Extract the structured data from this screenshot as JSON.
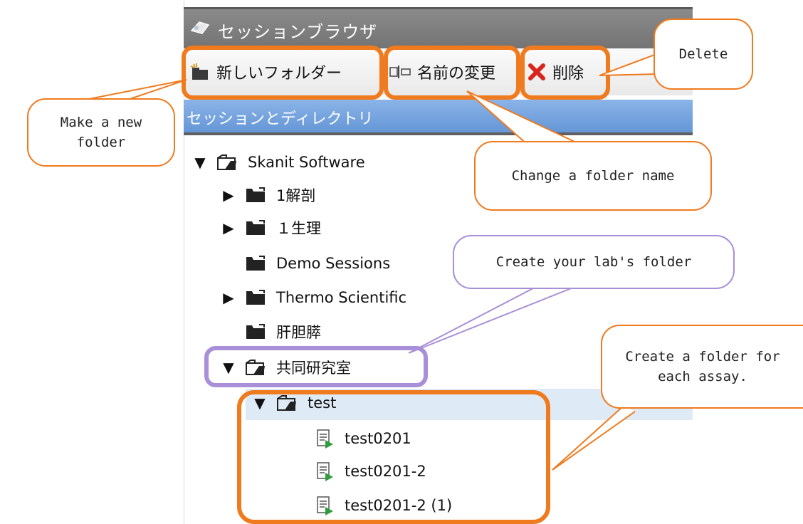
{
  "window": {
    "title": "セッションブラウザ",
    "title_icon": "session-browser-icon"
  },
  "toolbar": {
    "new_folder_label": "新しいフォルダー",
    "rename_label": "名前の変更",
    "delete_label": "削除"
  },
  "section": {
    "title": "セッションとディレクトリ"
  },
  "tree": {
    "items": [
      {
        "label": "Skanit Software",
        "arrow": "▼"
      },
      {
        "label": "1解剖",
        "arrow": "▶"
      },
      {
        "label": "１生理",
        "arrow": "▶"
      },
      {
        "label": "Demo Sessions",
        "arrow": ""
      },
      {
        "label": "Thermo Scientific",
        "arrow": "▶"
      },
      {
        "label": "肝胆膵",
        "arrow": ""
      },
      {
        "label": "共同研究室",
        "arrow": "▼"
      },
      {
        "label": "test",
        "arrow": "▼"
      },
      {
        "label": "test0201",
        "arrow": ""
      },
      {
        "label": "test0201-2",
        "arrow": ""
      },
      {
        "label": "test0201-2 (1)",
        "arrow": ""
      }
    ]
  },
  "callouts": {
    "new_folder": "Make a new folder",
    "delete": "Delete",
    "rename": "Change a folder name",
    "lab_folder": "Create your lab's folder",
    "assay_folder": "Create a folder for each assay."
  },
  "colors": {
    "highlight_orange": "#f07a1e",
    "highlight_purple": "#a88fd8",
    "section_blue": "#6f9ed9",
    "selected_row": "#dfeaf7"
  }
}
